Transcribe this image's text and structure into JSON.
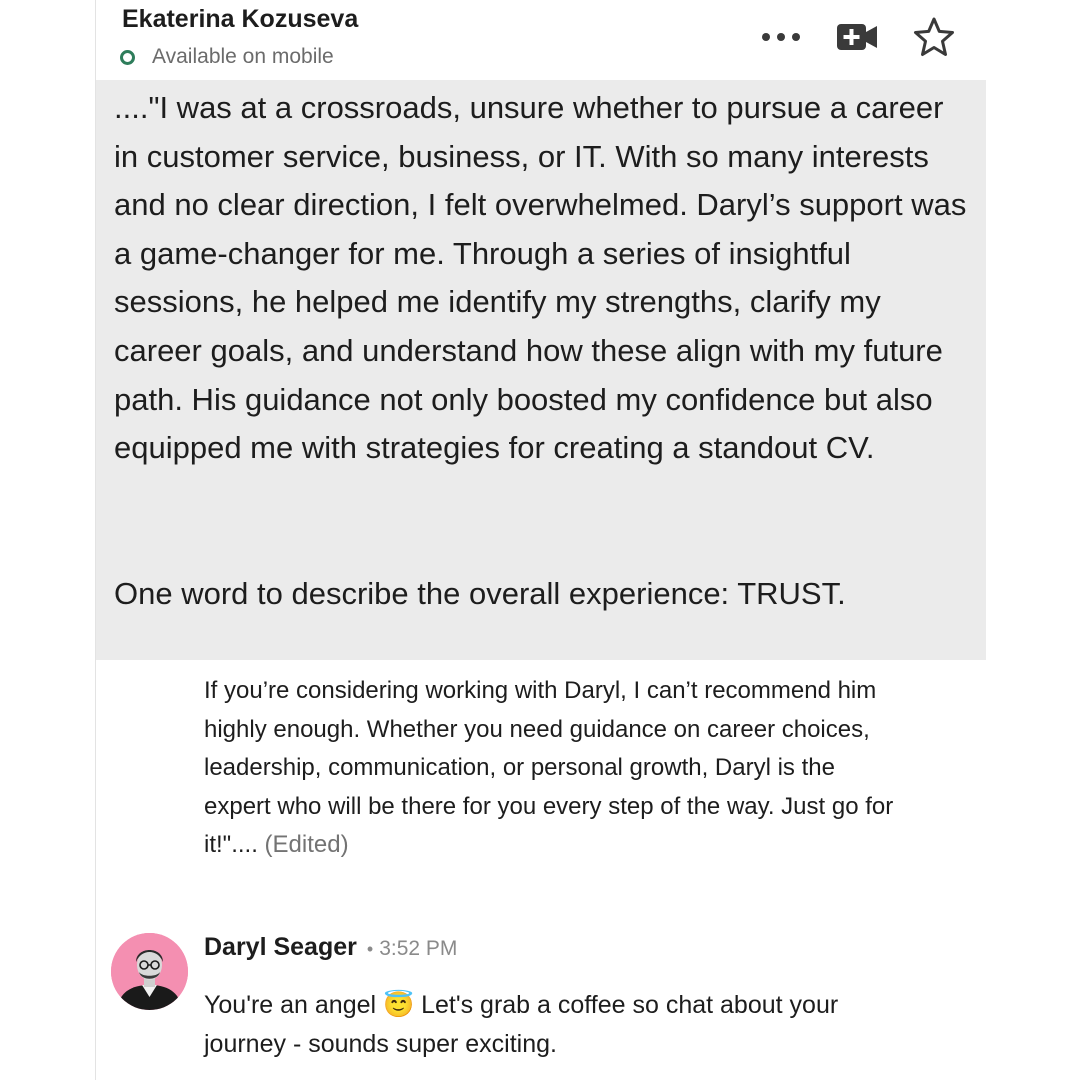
{
  "header": {
    "contact_name": "Ekaterina Kozuseva",
    "status": "Available on mobile",
    "status_color": "#2e7d5b",
    "actions": [
      {
        "name": "more-options",
        "icon": "ellipsis-icon"
      },
      {
        "name": "video-call",
        "icon": "video-plus-icon"
      },
      {
        "name": "favorite",
        "icon": "star-outline-icon"
      }
    ]
  },
  "quote": {
    "text": "....\"I was at a crossroads, unsure whether to pursue a career in customer service, business, or IT. With so many interests and no clear direction, I felt overwhelmed. Daryl’s support was a game-changer for me. Through a series of insightful sessions, he helped me identify my strengths, clarify my career goals, and understand how these align with my future path. His guidance not only boosted my confidence but also equipped me with strategies for creating a standout CV.",
    "summary": "One word to describe the overall experience: TRUST.",
    "background": "#ebebeb"
  },
  "continued_message": {
    "text": "If you’re considering working with Daryl, I can’t recommend him highly enough. Whether you need guidance on career choices, leadership, communication, or personal growth, Daryl is the expert who will be there for you every step of the way. Just go for it!\"....",
    "edited_label": "(Edited)"
  },
  "reply": {
    "sender": "Daryl Seager",
    "separator": "•",
    "time": "3:52 PM",
    "text": "You're an angel 😇 Let's grab a coffee so chat about your journey - sounds super exciting.",
    "avatar_background": "#f48fb1"
  }
}
